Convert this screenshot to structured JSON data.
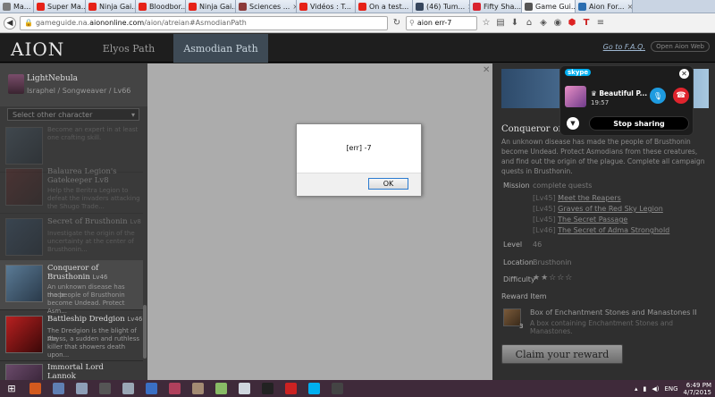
{
  "browser": {
    "tabs": [
      {
        "label": "Ma...",
        "color": "#7a7a7a"
      },
      {
        "label": "Super Ma...",
        "color": "#e62117"
      },
      {
        "label": "Ninja Gai...",
        "color": "#e62117"
      },
      {
        "label": "Bloodbor...",
        "color": "#e62117"
      },
      {
        "label": "Ninja Gai...",
        "color": "#e62117"
      },
      {
        "label": "Sciences ...",
        "color": "#8b3a3a"
      },
      {
        "label": "Vidéos : T...",
        "color": "#e62117"
      },
      {
        "label": "On a test...",
        "color": "#e62117"
      },
      {
        "label": "(46) Tum...",
        "color": "#36465d"
      },
      {
        "label": "Fifty Sha...",
        "color": "#d9232e"
      },
      {
        "label": "Game Gui...",
        "color": "#555555"
      },
      {
        "label": "Aion For...",
        "color": "#2a6db0"
      }
    ],
    "url_prefix": "gameguide.na.",
    "url_domain": "aiononline.com",
    "url_path": "/aion/atreian#AsmodianPath",
    "search_value": "aion err-7"
  },
  "site": {
    "logo": "AION",
    "nav_elyos": "Elyos Path",
    "nav_asmodian": "Asmodian Path",
    "faq": "Go to F.A.Q.",
    "open_web": "Open Aion Web"
  },
  "profile": {
    "name": "LightNebula",
    "class_line": "Israphel / Songweaver / Lv66",
    "select_placeholder": "Select other character"
  },
  "quests": [
    {
      "title": "",
      "level": "",
      "desc": [
        "Become an expert in at least",
        "one crafting skill."
      ]
    },
    {
      "title": "Balaurea Legion's",
      "level": "",
      "title2": "Gatekeeper Lv8",
      "desc": [
        "Help the Beritra Legion to",
        "defeat the invaders attacking",
        "the Shugo Trade..."
      ]
    },
    {
      "title": "Secret of Brusthonin",
      "level": "Lv8",
      "desc": [
        "Investigate the origin of the",
        "uncertainty at the center of",
        "Brusthonin..."
      ]
    },
    {
      "title": "Conqueror of",
      "title2": "Brusthonin",
      "level": "Lv46",
      "desc": [
        "An unknown disease has made",
        "the people of Brusthonin",
        "become Undead. Protect Asm..."
      ]
    },
    {
      "title": "Battleship Dredgion",
      "level": "Lv46",
      "desc": [
        "The Dredgion is the blight of the",
        "Abyss, a sudden and ruthless",
        "killer that showers death upon..."
      ]
    },
    {
      "title": "Immortal Lord",
      "title2": "Lannok",
      "level": "",
      "desc": []
    }
  ],
  "detail": {
    "title": "Conqueror of Brusthonin",
    "description": "An unknown disease has made the people of Brusthonin become Undead. Protect Asmodians from these creatures, and find out the origin of the plague. Complete all campaign quests in Brusthonin.",
    "mission_label": "Mission",
    "mission_value": "complete quests",
    "quest_links": [
      {
        "lv": "[Lv45]",
        "name": "Meet the Reapers"
      },
      {
        "lv": "[Lv45]",
        "name": "Graves of the Red Sky Legion"
      },
      {
        "lv": "[Lv45]",
        "name": "The Secret Passage"
      },
      {
        "lv": "[Lv46]",
        "name": "The Secret of Adma Stronghold"
      }
    ],
    "level_label": "Level",
    "level_value": "46",
    "location_label": "Location",
    "location_value": "Brusthonin",
    "difficulty_label": "Difficulty",
    "difficulty_stars": "★★☆☆☆",
    "difficulty_rating": 2,
    "reward_head": "Reward Item",
    "reward_name": "Box of Enchantment Stones and Manastones II",
    "reward_desc": "A box containing Enchantment Stones and Manastones.",
    "reward_qty": "3",
    "claim_label": "Claim your reward"
  },
  "skype": {
    "logo": "skype",
    "caller": "♛ Beautiful P...",
    "time": "19:57",
    "stop_label": "Stop sharing"
  },
  "dialog": {
    "message": "[err] -7",
    "ok_label": "OK"
  },
  "taskbar": {
    "apps": [
      "#d25a1e",
      "#5f7fb3",
      "#8e9fb8",
      "#555555",
      "#9aa7b5",
      "#3a6fc4",
      "#b0405c",
      "#a38b73",
      "#88bb66",
      "#cfd6de",
      "#222222",
      "#cc2222",
      "#00aff0",
      "#444444"
    ],
    "lang": "ENG",
    "time": "6:49 PM",
    "date": "4/7/2015"
  }
}
